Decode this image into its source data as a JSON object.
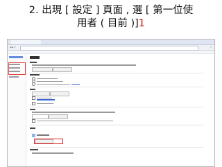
{
  "slide": {
    "title_line1": "2. 出現 [ 設定 ] 頁面 , 選 [ 第一位使",
    "title_line2_prefix": "用者 ( 目前 )]",
    "title_line2_red": "1"
  },
  "screenshot": {
    "nav_glyph": "◀ ▶ ⟳",
    "star_glyph": "☆"
  },
  "colors": {
    "accent_red": "#d01010",
    "link_blue": "#3367d6"
  }
}
